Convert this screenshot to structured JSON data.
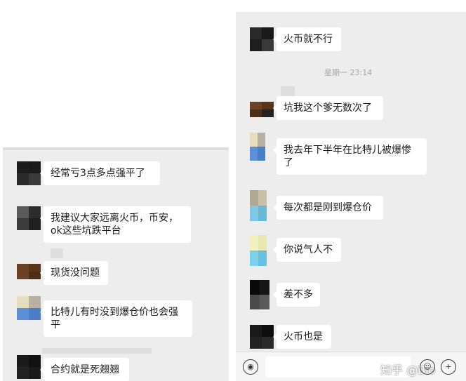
{
  "left_chat": {
    "messages": [
      {
        "text": "经常亏3点多点强平了",
        "avatar_colors": [
          "#1c1c1c",
          "#1a1a1a",
          "#2a2a2a",
          "#3a3a3a"
        ]
      },
      {
        "text": "我建议大家远离火币，币安，ok这些坑跌平台",
        "avatar_colors": [
          "#5a5a5a",
          "#2c2c2c",
          "#3c3c3c",
          "#202020"
        ]
      },
      {
        "text": "现货没问题",
        "avatar_colors": [
          "#6b4226",
          "#5a3419",
          "#6b4226",
          "#4d2e17"
        ]
      },
      {
        "text": "比特儿有时没到爆仓价也会强平",
        "avatar_colors": [
          "#e6dcc0",
          "#b8b0a0",
          "#5b8fd8",
          "#4a7fc8"
        ]
      },
      {
        "text": "合约就是死翘翘",
        "avatar_colors": [
          "#1a1a1a",
          "#111111",
          "#222222",
          "#1a1a1a"
        ]
      }
    ]
  },
  "right_chat": {
    "messages_before": [
      {
        "text": "火币就不行",
        "avatar_colors": [
          "#2a2a2a",
          "#1a1a1a",
          "#1e1e1e",
          "#3a3a3a"
        ]
      }
    ],
    "timestamp": "星期一 23:14",
    "messages_after": [
      {
        "text": "坑我这个爹无数次了",
        "avatar_colors": [
          "#6b4226",
          "#5a3419",
          "#4d2e17",
          "#222222"
        ]
      },
      {
        "text": "我去年下半年在比特儿被爆惨了",
        "avatar_colors": [
          "#e6dcc0",
          "#b8b0a0",
          "#5b8fd8",
          "#4a7fc8"
        ]
      },
      {
        "text": "每次都是刚到爆仓价",
        "avatar_colors": [
          "#b0a890",
          "#c8c0a8",
          "#7ec8e3",
          "#6ab8d8"
        ]
      },
      {
        "text": "你说气人不",
        "avatar_colors": [
          "#f0f0c0",
          "#e8e8b0",
          "#7ed0e8",
          "#6ac0e0"
        ]
      },
      {
        "text": "差不多",
        "avatar_colors": [
          "#0a0a0a",
          "#151515",
          "#4a4a4a",
          "#5a5a5a"
        ]
      },
      {
        "text": "火币也是",
        "avatar_colors": [
          "#1a1a1a",
          "#0e0e0e",
          "#222222",
          "#2a2a2a"
        ]
      }
    ],
    "bottom_bar": {
      "voice_icon_glyph": "◉",
      "watermark": "知乎 @Bio"
    }
  }
}
